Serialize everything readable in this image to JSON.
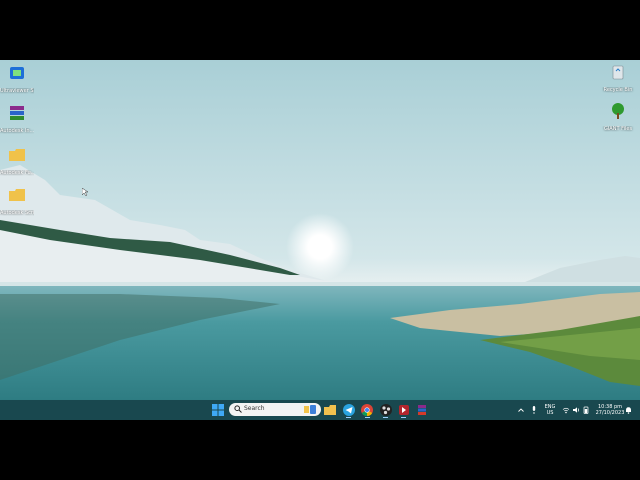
{
  "desktop": {
    "icons_left": [
      {
        "label": "Ultraviewer Sh...",
        "icon": "ultraviewer-icon"
      },
      {
        "label": "Autodesk In...",
        "icon": "winrar-archive-icon"
      },
      {
        "label": "Autodesk Fu...",
        "icon": "folder-icon"
      },
      {
        "label": "Autodesk Scriptin...",
        "icon": "folder-icon"
      }
    ],
    "icons_right": [
      {
        "label": "Recycle Bin",
        "icon": "recycle-bin-icon"
      },
      {
        "label": "GIANT Files",
        "icon": "tree-icon"
      }
    ]
  },
  "taskbar": {
    "search_placeholder": "Search",
    "apps": [
      "start-icon",
      "search-field",
      "file-explorer-icon",
      "telegram-icon",
      "chrome-icon",
      "obs-icon",
      "red-app-icon",
      "winrar-icon"
    ],
    "tray": {
      "language_top": "ENG",
      "language_bottom": "US",
      "time": "10:38 pm",
      "date": "27/10/2023"
    }
  },
  "colors": {
    "taskbar_bg": "#19484f",
    "sky_top": "#b3d4d8",
    "water": "#3a8a8c"
  }
}
